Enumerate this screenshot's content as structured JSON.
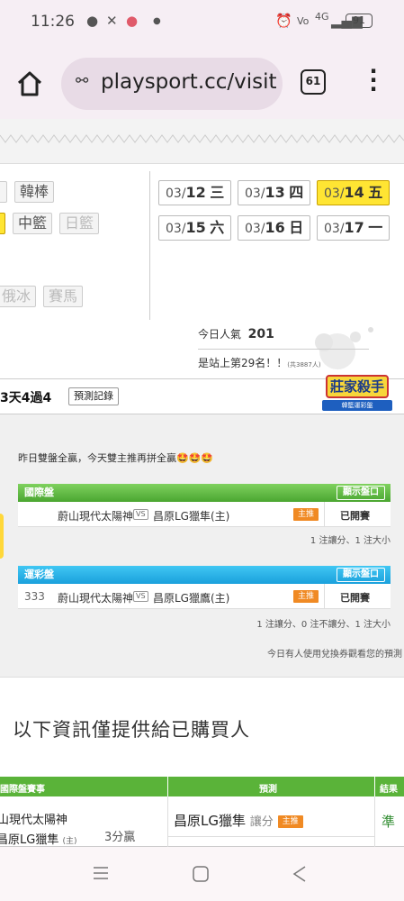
{
  "status": {
    "time": "11:26",
    "battery": "91",
    "signal": "4G"
  },
  "browser": {
    "url": "playsport.cc/visit",
    "tab_count": "61"
  },
  "sports": {
    "row1": [
      "韓棒"
    ],
    "row2": [
      "中籃",
      "日籃"
    ],
    "row3": [
      "俄冰",
      "賽馬"
    ]
  },
  "dates": [
    {
      "md": "03/",
      "d": "12",
      "w": "三"
    },
    {
      "md": "03/",
      "d": "13",
      "w": "四"
    },
    {
      "md": "03/",
      "d": "14",
      "w": "五"
    },
    {
      "md": "03/",
      "d": "15",
      "w": "六"
    },
    {
      "md": "03/",
      "d": "16",
      "w": "日"
    },
    {
      "md": "03/",
      "d": "17",
      "w": "一"
    }
  ],
  "stats": {
    "pop_label": "今日人氣",
    "pop_value": "201",
    "rank_text": "是站上第29名！！",
    "rank_total": "(共3887人)"
  },
  "banner": {
    "record_text": "3天4過4",
    "record_btn": "預測記錄",
    "logo_text": "莊家殺手",
    "logo_sub": "韓籃運彩盤"
  },
  "panel": {
    "intro": "昨日雙盤全贏，今天雙主推再拼全贏🤩🤩🤩",
    "intl": {
      "title": "國際盤",
      "show": "顯示盤口",
      "num": "",
      "away": "蔚山現代太陽神",
      "vs": "VS",
      "home": "昌原LG獵隼(主)",
      "badge": "主推",
      "status": "已開賽",
      "note": "1 注讓分、1 注大小"
    },
    "lottery": {
      "title": "運彩盤",
      "show": "顯示盤口",
      "num": "333",
      "away": "蔚山現代太陽神",
      "vs": "VS",
      "home": "昌原LG獵鷹(主)",
      "badge": "主推",
      "status": "已開賽",
      "note": "1 注讓分、0 注不讓分、1 注大小"
    },
    "footer": "今日有人使用兌換券觀看您的預測"
  },
  "buyers": {
    "heading": "以下資訊僅提供給已購買人",
    "cols": [
      "國際盤賽事",
      "預測",
      "結果"
    ],
    "row": {
      "team1": "蔚山現代太陽神",
      "team2": "昌原LG獵隼",
      "home_tag": "(主)",
      "score": "3分贏",
      "pick": "昌原LG獵隼",
      "pick_type": "讓分",
      "badge": "主推",
      "result": "準"
    }
  },
  "colors": {
    "accent_green": "#5ab339",
    "accent_blue": "#1aa0dc",
    "highlight": "#ffe533",
    "badge_orange": "#f08a24",
    "result_green": "#2e8b2e"
  }
}
